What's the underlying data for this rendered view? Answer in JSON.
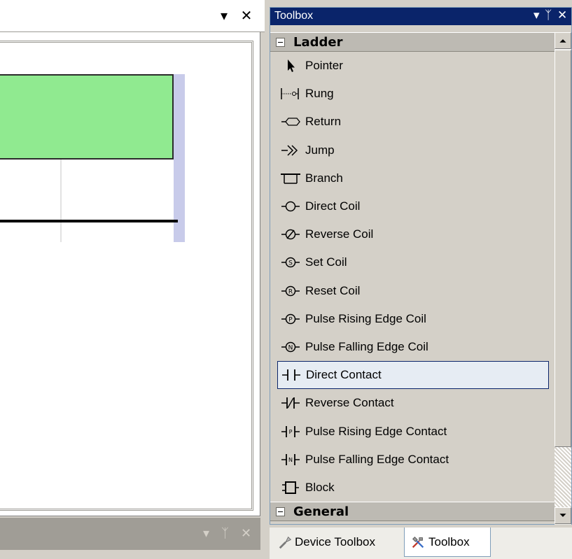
{
  "document": {
    "dropdown_glyph": "▾",
    "close_glyph": "✕",
    "bottom_pane": {
      "dropdown_glyph": "▾",
      "pin_glyph": "ᛉ",
      "close_glyph": "✕"
    }
  },
  "toolbox": {
    "title": "Toolbox",
    "title_buttons": {
      "dropdown": "▾",
      "pin": "ᛉ",
      "close": "✕"
    },
    "groups": [
      {
        "label": "Ladder",
        "expanded": true,
        "items": [
          {
            "label": "Pointer",
            "icon": "pointer-icon"
          },
          {
            "label": "Rung",
            "icon": "rung-icon"
          },
          {
            "label": "Return",
            "icon": "return-icon"
          },
          {
            "label": "Jump",
            "icon": "jump-icon"
          },
          {
            "label": "Branch",
            "icon": "branch-icon"
          },
          {
            "label": "Direct Coil",
            "icon": "direct-coil-icon"
          },
          {
            "label": "Reverse Coil",
            "icon": "reverse-coil-icon"
          },
          {
            "label": "Set Coil",
            "icon": "set-coil-icon"
          },
          {
            "label": "Reset Coil",
            "icon": "reset-coil-icon"
          },
          {
            "label": "Pulse Rising Edge Coil",
            "icon": "pulse-rising-edge-coil-icon"
          },
          {
            "label": "Pulse Falling Edge Coil",
            "icon": "pulse-falling-edge-coil-icon"
          },
          {
            "label": "Direct Contact",
            "icon": "direct-contact-icon",
            "selected": true
          },
          {
            "label": "Reverse Contact",
            "icon": "reverse-contact-icon"
          },
          {
            "label": "Pulse Rising Edge Contact",
            "icon": "pulse-rising-edge-contact-icon"
          },
          {
            "label": "Pulse Falling Edge Contact",
            "icon": "pulse-falling-edge-contact-icon"
          },
          {
            "label": "Block",
            "icon": "block-icon"
          }
        ]
      },
      {
        "label": "General",
        "expanded": true,
        "items": []
      }
    ],
    "icon_glyphs": {
      "coil_set": "S",
      "coil_reset": "R",
      "coil_pulse_rising": "P",
      "coil_pulse_falling": "N",
      "contact_pulse_rising": "P",
      "contact_pulse_falling": "N"
    }
  },
  "tabs": [
    {
      "label": "Device Toolbox",
      "icon": "device-toolbox-icon",
      "active": false
    },
    {
      "label": "Toolbox",
      "icon": "toolbox-tools-icon",
      "active": true
    }
  ],
  "colors": {
    "title_bar": "#0a246a",
    "rung_green": "#90ea90",
    "power_rail": "#c8cbea",
    "selection_bg": "#e6ecf3"
  }
}
